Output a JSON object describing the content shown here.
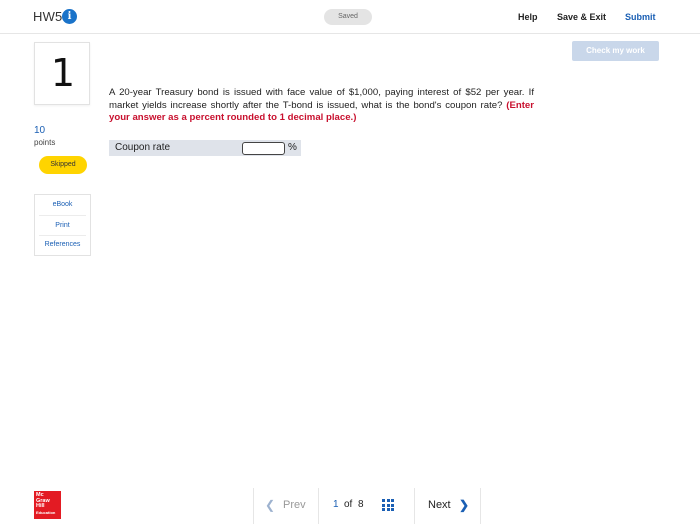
{
  "header": {
    "assignment_title": "HW5",
    "info_icon": "info-icon",
    "save_status": "Saved",
    "help_label": "Help",
    "save_exit_label": "Save & Exit",
    "submit_label": "Submit"
  },
  "check_work_label": "Check my work",
  "question": {
    "number": "1",
    "points_value": "10",
    "points_label": "points",
    "status_badge": "Skipped",
    "text_main": "A 20-year Treasury bond is issued with face value of $1,000, paying interest of $52 per year. If market yields increase shortly after the T-bond is issued, what is the bond's coupon rate?",
    "text_emphasis": "(Enter your answer as a percent rounded to 1 decimal place.)",
    "answer_label": "Coupon rate",
    "answer_value": "",
    "answer_unit": "%"
  },
  "tools": {
    "ebook": "eBook",
    "print": "Print",
    "references": "References"
  },
  "footer": {
    "logo_text": "Mc Graw Hill Education",
    "prev_label": "Prev",
    "current_page": "1",
    "of_label": "of",
    "total_pages": "8",
    "next_label": "Next"
  },
  "colors": {
    "accent": "#1a5fb4",
    "emphasis_red": "#c8102e",
    "badge_yellow": "#ffd400",
    "logo_red": "#e31b23"
  }
}
